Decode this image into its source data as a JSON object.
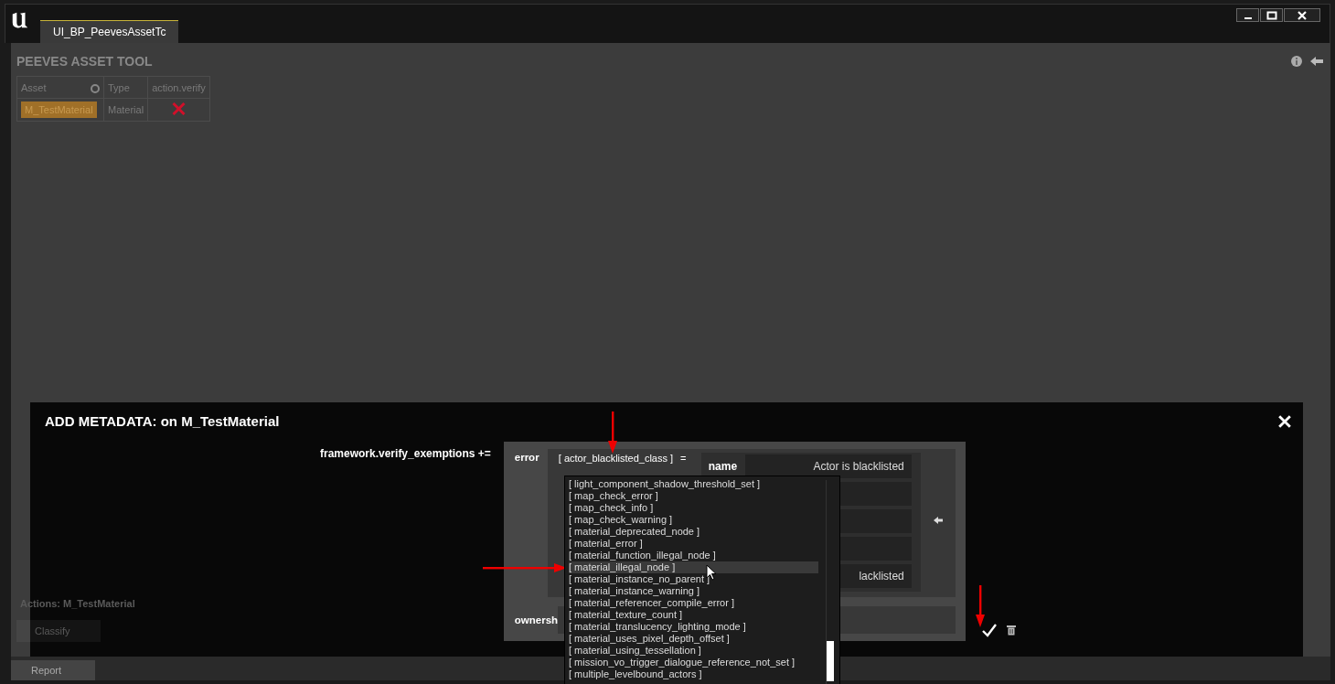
{
  "window": {
    "tab": {
      "label": "UI_BP_PeevesAssetTc",
      "selected": true
    }
  },
  "tool": {
    "title": "PEEVES ASSET TOOL",
    "table": {
      "columns": [
        "Asset",
        "Type",
        "action.verify"
      ],
      "rows": [
        {
          "asset": "M_TestMaterial",
          "type": "Material",
          "failed": true,
          "selected": true
        }
      ]
    }
  },
  "actions_panel": {
    "title": "Actions: M_TestMaterial",
    "buttons": [
      "Classify",
      "Report"
    ]
  },
  "dialog": {
    "title": "ADD METADATA: on M_TestMaterial",
    "property": "framework.verify_exemptions +=",
    "entry": {
      "label": "error",
      "key": "[ actor_blacklisted_class ]",
      "operator": "=",
      "fields": [
        {
          "kind": "field",
          "label": "name",
          "value": "Actor is blacklisted"
        },
        {
          "kind": "field"
        },
        {
          "kind": "field"
        },
        {
          "kind": "field"
        },
        {
          "kind": "field",
          "value": "lacklisted"
        }
      ]
    },
    "ownership_label": "ownersh",
    "dropdown": {
      "items": [
        {
          "label": "[ light_component_shadow_threshold_set ]",
          "selected": false
        },
        {
          "label": "[ map_check_error ]",
          "selected": false
        },
        {
          "label": "[ map_check_info ]",
          "selected": false
        },
        {
          "label": "[ map_check_warning ]",
          "selected": false
        },
        {
          "label": "[ material_deprecated_node ]",
          "selected": false
        },
        {
          "label": "[ material_error ]",
          "selected": false
        },
        {
          "label": "[ material_function_illegal_node ]",
          "selected": false
        },
        {
          "label": "[ material_illegal_node ]",
          "selected": true
        },
        {
          "label": "[ material_instance_no_parent ]",
          "selected": false
        },
        {
          "label": "[ material_instance_warning ]",
          "selected": false
        },
        {
          "label": "[ material_referencer_compile_error ]",
          "selected": false
        },
        {
          "label": "[ material_texture_count ]",
          "selected": false
        },
        {
          "label": "[ material_translucency_lighting_mode ]",
          "selected": false
        },
        {
          "label": "[ material_uses_pixel_depth_offset ]",
          "selected": false
        },
        {
          "label": "[ material_using_tessellation ]",
          "selected": false
        },
        {
          "label": "[ mission_vo_trigger_dialogue_reference_not_set ]",
          "selected": false
        },
        {
          "label": "[ multiple_levelbound_actors ]",
          "selected": false
        }
      ]
    },
    "annotations": [
      {
        "kind": "arrow_down"
      },
      {
        "kind": "arrow_right"
      },
      {
        "kind": "arrow_down"
      }
    ]
  }
}
